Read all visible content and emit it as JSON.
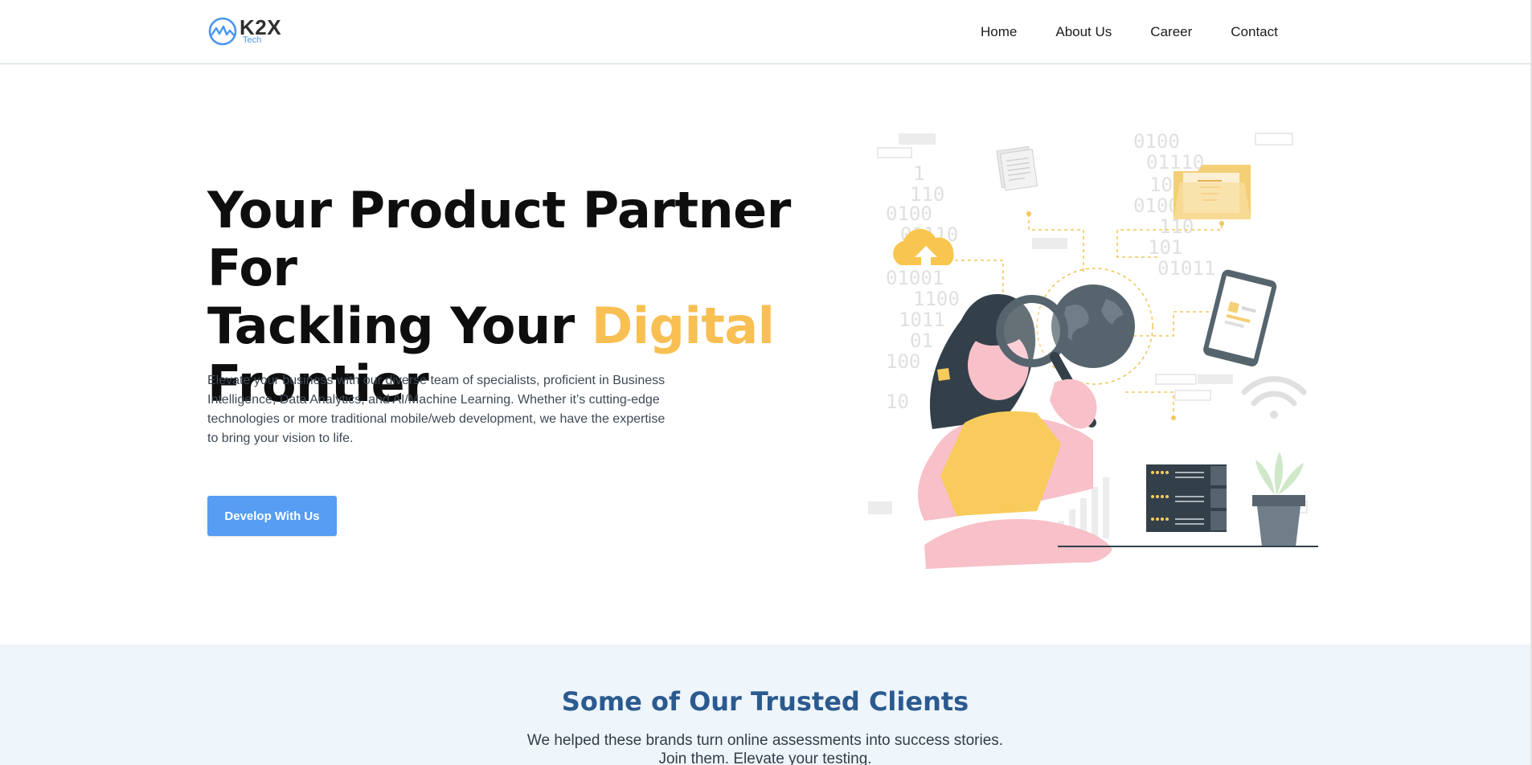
{
  "header": {
    "logo": {
      "brand": "K2X",
      "sub": "Tech",
      "icon": "mountain-circle-logo"
    },
    "nav": [
      {
        "label": "Home"
      },
      {
        "label": "About Us"
      },
      {
        "label": "Career"
      },
      {
        "label": "Contact"
      }
    ]
  },
  "hero": {
    "title_line1": "Your Product Partner For",
    "title_line2_prefix": "Tackling Your ",
    "title_accent": "Digital",
    "title_line3": "Frontier",
    "description": "Elevate your business with our diverse team of specialists, proficient in Business Intelligence, Data Analytics, and AI/Machine Learning. Whether it’s cutting-edge technologies or more traditional mobile/web development, we have the expertise to bring your vision to life.",
    "cta_label": "Develop With Us",
    "illustration": {
      "icon": "woman-magnifying-glass-illustration",
      "binary_text": [
        "0100",
        "01110",
        "1010",
        "0100",
        "110",
        "101",
        "01011",
        "1",
        "110",
        "0100",
        "01110",
        "01001",
        "1100",
        "1011",
        "01",
        "100",
        "10"
      ]
    }
  },
  "clients": {
    "title": "Some of Our Trusted Clients",
    "subtitle_line1": "We helped these brands turn online assessments into success stories.",
    "subtitle_line2": "Join them. Elevate your testing."
  },
  "colors": {
    "accent": "#f8bf52",
    "primary_button": "#569df3",
    "clients_title": "#2b5a8f",
    "clients_bg": "#eef5fb"
  }
}
